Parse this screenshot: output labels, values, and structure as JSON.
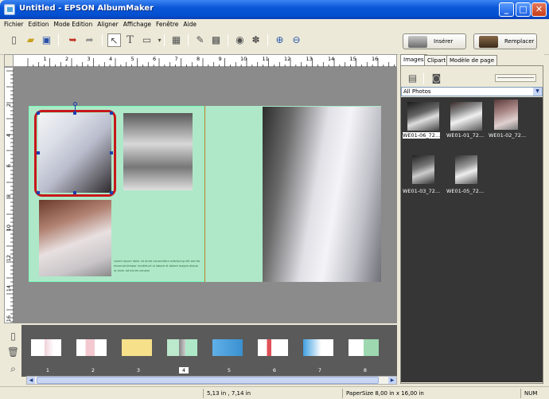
{
  "window": {
    "title": "Untitled - EPSON AlbumMaker"
  },
  "menu": [
    "Fichier",
    "Edition",
    "Mode Edition",
    "Aligner",
    "Affichage",
    "Fenêtre",
    "Aide"
  ],
  "toolbar": {
    "icons": [
      "new-page-icon",
      "open-folder-icon",
      "save-icon",
      "undo-icon",
      "redo-icon",
      "select-arrow-icon",
      "text-icon",
      "shape-icon",
      "layout-icon",
      "frame-icon",
      "brush-icon",
      "crop-icon",
      "effects-icon",
      "stamp-icon",
      "zoom-in-icon",
      "zoom-out-icon"
    ],
    "insert_label": "Insérer",
    "replace_label": "Remplacer"
  },
  "ruler": {
    "h_numbers": [
      "1",
      "2",
      "3",
      "4",
      "5",
      "6",
      "7",
      "8",
      "9",
      "10",
      "11",
      "12",
      "13",
      "14",
      "15",
      "16"
    ],
    "v_numbers": [
      "2",
      "4",
      "6",
      "8",
      "10",
      "12",
      "14",
      "16"
    ]
  },
  "caption_text": "Lorem ipsum dolor sit amet consectetur adipiscing elit sed do eiusmod tempor incididunt ut labore et dolore magna aliqua ut enim ad minim veniam",
  "thumbnails": {
    "page_numbers": [
      "1",
      "2",
      "3",
      "4",
      "5",
      "6",
      "7",
      "8"
    ],
    "selected": "4"
  },
  "panel": {
    "tabs": [
      "Images",
      "Clipart",
      "Modèle de page"
    ],
    "active_tab": "Images",
    "folder": "All Photos",
    "images": [
      {
        "label": "WE01-06_72...",
        "selected": true
      },
      {
        "label": "WE01-01_72...",
        "selected": false
      },
      {
        "label": "WE01-02_72...",
        "selected": false
      },
      {
        "label": "WE01-03_72...",
        "selected": false
      },
      {
        "label": "WE01-05_72...",
        "selected": false
      }
    ]
  },
  "status": {
    "position": "5,13 in , 7,14 in",
    "paper": "PaperSize  8,00 in x 16,00 in",
    "num": "NUM"
  },
  "colors": {
    "page_bg": "#aee8c8",
    "selection": "#c8171b",
    "spine": "#e07030",
    "titlebar": "#0a56d8"
  }
}
